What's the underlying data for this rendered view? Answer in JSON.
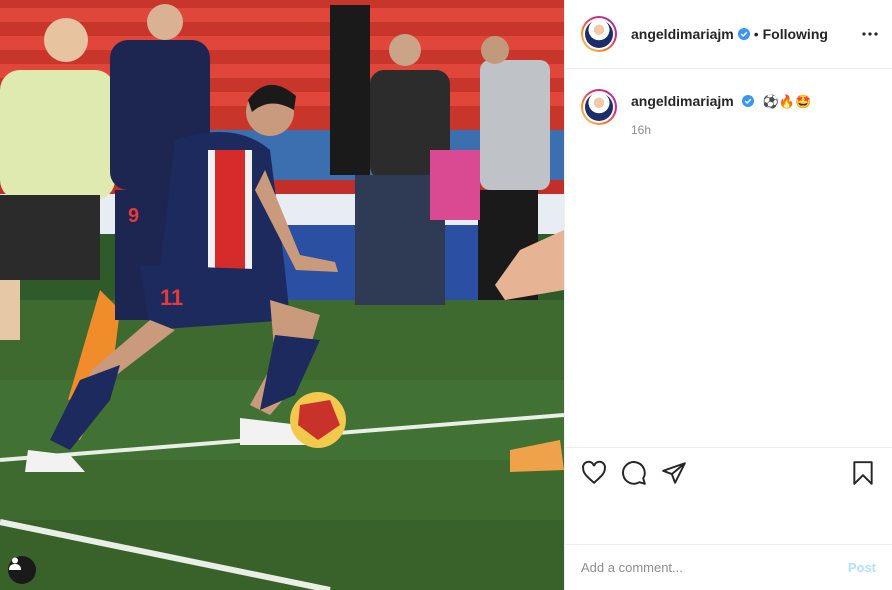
{
  "post": {
    "username": "angeldimariajm",
    "follow_status": "Following",
    "separator": "•",
    "caption_emojis": "⚽🔥🤩",
    "timestamp": "16h",
    "comment_placeholder": "Add a comment...",
    "post_label": "Post"
  },
  "photo": {
    "player_number": "11",
    "sub_number": "9"
  },
  "colors": {
    "verified": "#3897f0",
    "post_button_disabled": "#b2dffc",
    "pitch": "#3e6a2f",
    "psg_navy": "#1d2a5e",
    "stand_red": "#d93a2e"
  },
  "icons": [
    "verified-badge-icon",
    "more-options-icon",
    "heart-icon",
    "comment-icon",
    "share-icon",
    "bookmark-icon",
    "user-tag-icon"
  ]
}
